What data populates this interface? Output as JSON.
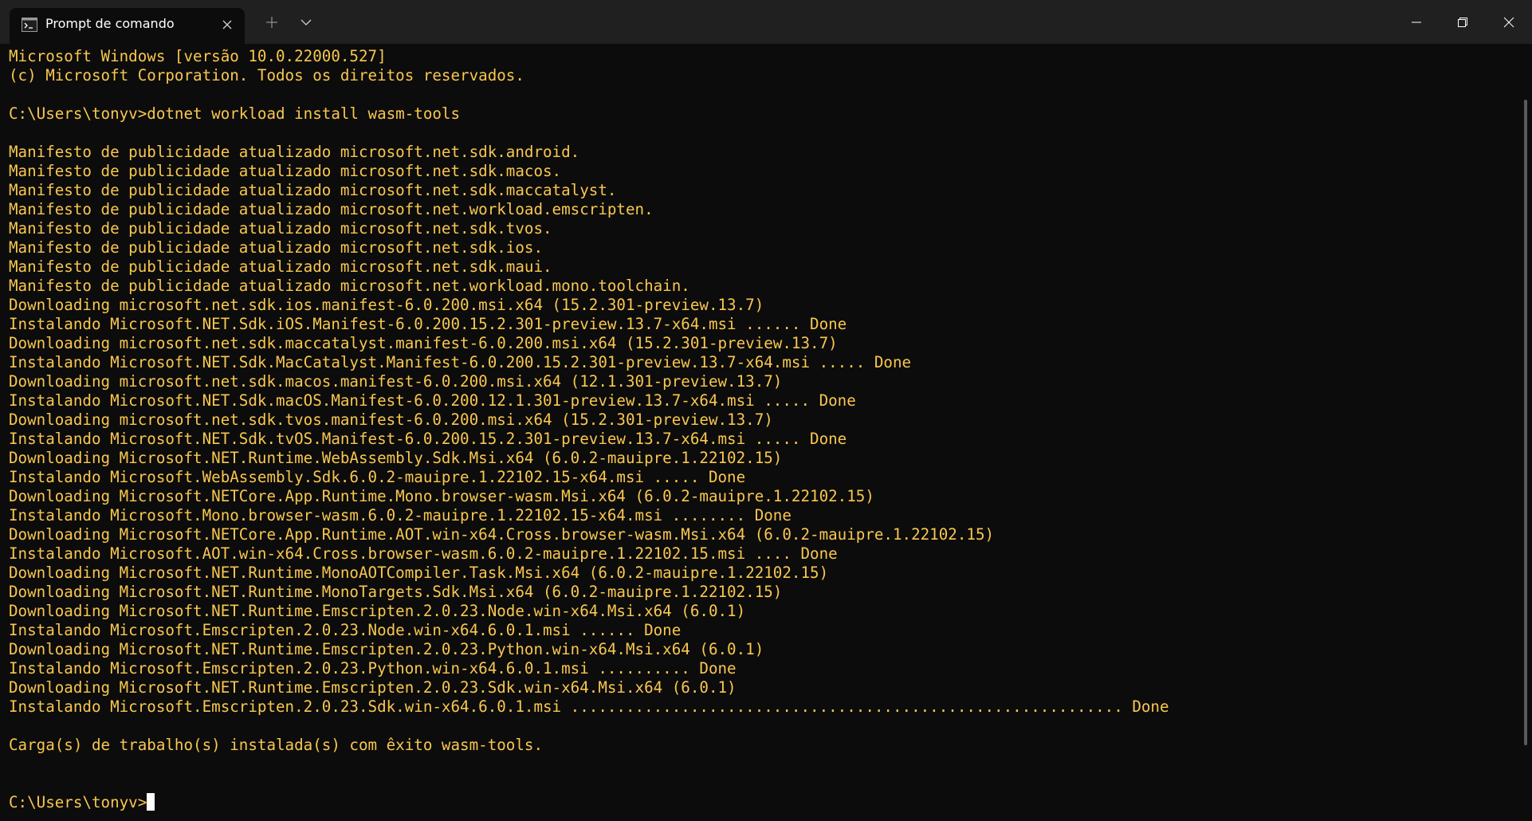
{
  "window": {
    "tab_title": "Prompt de comando",
    "icons": {
      "tab": "cmd-terminal-icon",
      "close_tab": "close-icon",
      "new_tab": "plus-icon",
      "dropdown": "chevron-down-icon",
      "minimize": "minimize-icon",
      "maximize": "restore-icon",
      "close_window": "close-icon"
    }
  },
  "colors": {
    "terminal_bg": "#0c0c0c",
    "terminal_fg": "#f9c74f",
    "titlebar_bg": "#202020"
  },
  "terminal": {
    "lines": [
      "Microsoft Windows [versão 10.0.22000.527]",
      "(c) Microsoft Corporation. Todos os direitos reservados.",
      "",
      "C:\\Users\\tonyv>dotnet workload install wasm-tools",
      "",
      "Manifesto de publicidade atualizado microsoft.net.sdk.android.",
      "Manifesto de publicidade atualizado microsoft.net.sdk.macos.",
      "Manifesto de publicidade atualizado microsoft.net.sdk.maccatalyst.",
      "Manifesto de publicidade atualizado microsoft.net.workload.emscripten.",
      "Manifesto de publicidade atualizado microsoft.net.sdk.tvos.",
      "Manifesto de publicidade atualizado microsoft.net.sdk.ios.",
      "Manifesto de publicidade atualizado microsoft.net.sdk.maui.",
      "Manifesto de publicidade atualizado microsoft.net.workload.mono.toolchain.",
      "Downloading microsoft.net.sdk.ios.manifest-6.0.200.msi.x64 (15.2.301-preview.13.7)",
      "Instalando Microsoft.NET.Sdk.iOS.Manifest-6.0.200.15.2.301-preview.13.7-x64.msi ...... Done",
      "Downloading microsoft.net.sdk.maccatalyst.manifest-6.0.200.msi.x64 (15.2.301-preview.13.7)",
      "Instalando Microsoft.NET.Sdk.MacCatalyst.Manifest-6.0.200.15.2.301-preview.13.7-x64.msi ..... Done",
      "Downloading microsoft.net.sdk.macos.manifest-6.0.200.msi.x64 (12.1.301-preview.13.7)",
      "Instalando Microsoft.NET.Sdk.macOS.Manifest-6.0.200.12.1.301-preview.13.7-x64.msi ..... Done",
      "Downloading microsoft.net.sdk.tvos.manifest-6.0.200.msi.x64 (15.2.301-preview.13.7)",
      "Instalando Microsoft.NET.Sdk.tvOS.Manifest-6.0.200.15.2.301-preview.13.7-x64.msi ..... Done",
      "Downloading Microsoft.NET.Runtime.WebAssembly.Sdk.Msi.x64 (6.0.2-mauipre.1.22102.15)",
      "Instalando Microsoft.WebAssembly.Sdk.6.0.2-mauipre.1.22102.15-x64.msi ..... Done",
      "Downloading Microsoft.NETCore.App.Runtime.Mono.browser-wasm.Msi.x64 (6.0.2-mauipre.1.22102.15)",
      "Instalando Microsoft.Mono.browser-wasm.6.0.2-mauipre.1.22102.15-x64.msi ........ Done",
      "Downloading Microsoft.NETCore.App.Runtime.AOT.win-x64.Cross.browser-wasm.Msi.x64 (6.0.2-mauipre.1.22102.15)",
      "Instalando Microsoft.AOT.win-x64.Cross.browser-wasm.6.0.2-mauipre.1.22102.15.msi .... Done",
      "Downloading Microsoft.NET.Runtime.MonoAOTCompiler.Task.Msi.x64 (6.0.2-mauipre.1.22102.15)",
      "Downloading Microsoft.NET.Runtime.MonoTargets.Sdk.Msi.x64 (6.0.2-mauipre.1.22102.15)",
      "Downloading Microsoft.NET.Runtime.Emscripten.2.0.23.Node.win-x64.Msi.x64 (6.0.1)",
      "Instalando Microsoft.Emscripten.2.0.23.Node.win-x64.6.0.1.msi ...... Done",
      "Downloading Microsoft.NET.Runtime.Emscripten.2.0.23.Python.win-x64.Msi.x64 (6.0.1)",
      "Instalando Microsoft.Emscripten.2.0.23.Python.win-x64.6.0.1.msi .......... Done",
      "Downloading Microsoft.NET.Runtime.Emscripten.2.0.23.Sdk.win-x64.Msi.x64 (6.0.1)",
      "Instalando Microsoft.Emscripten.2.0.23.Sdk.win-x64.6.0.1.msi ............................................................ Done",
      "",
      "Carga(s) de trabalho(s) instalada(s) com êxito wasm-tools.",
      "",
      ""
    ],
    "prompt": "C:\\Users\\tonyv>"
  }
}
